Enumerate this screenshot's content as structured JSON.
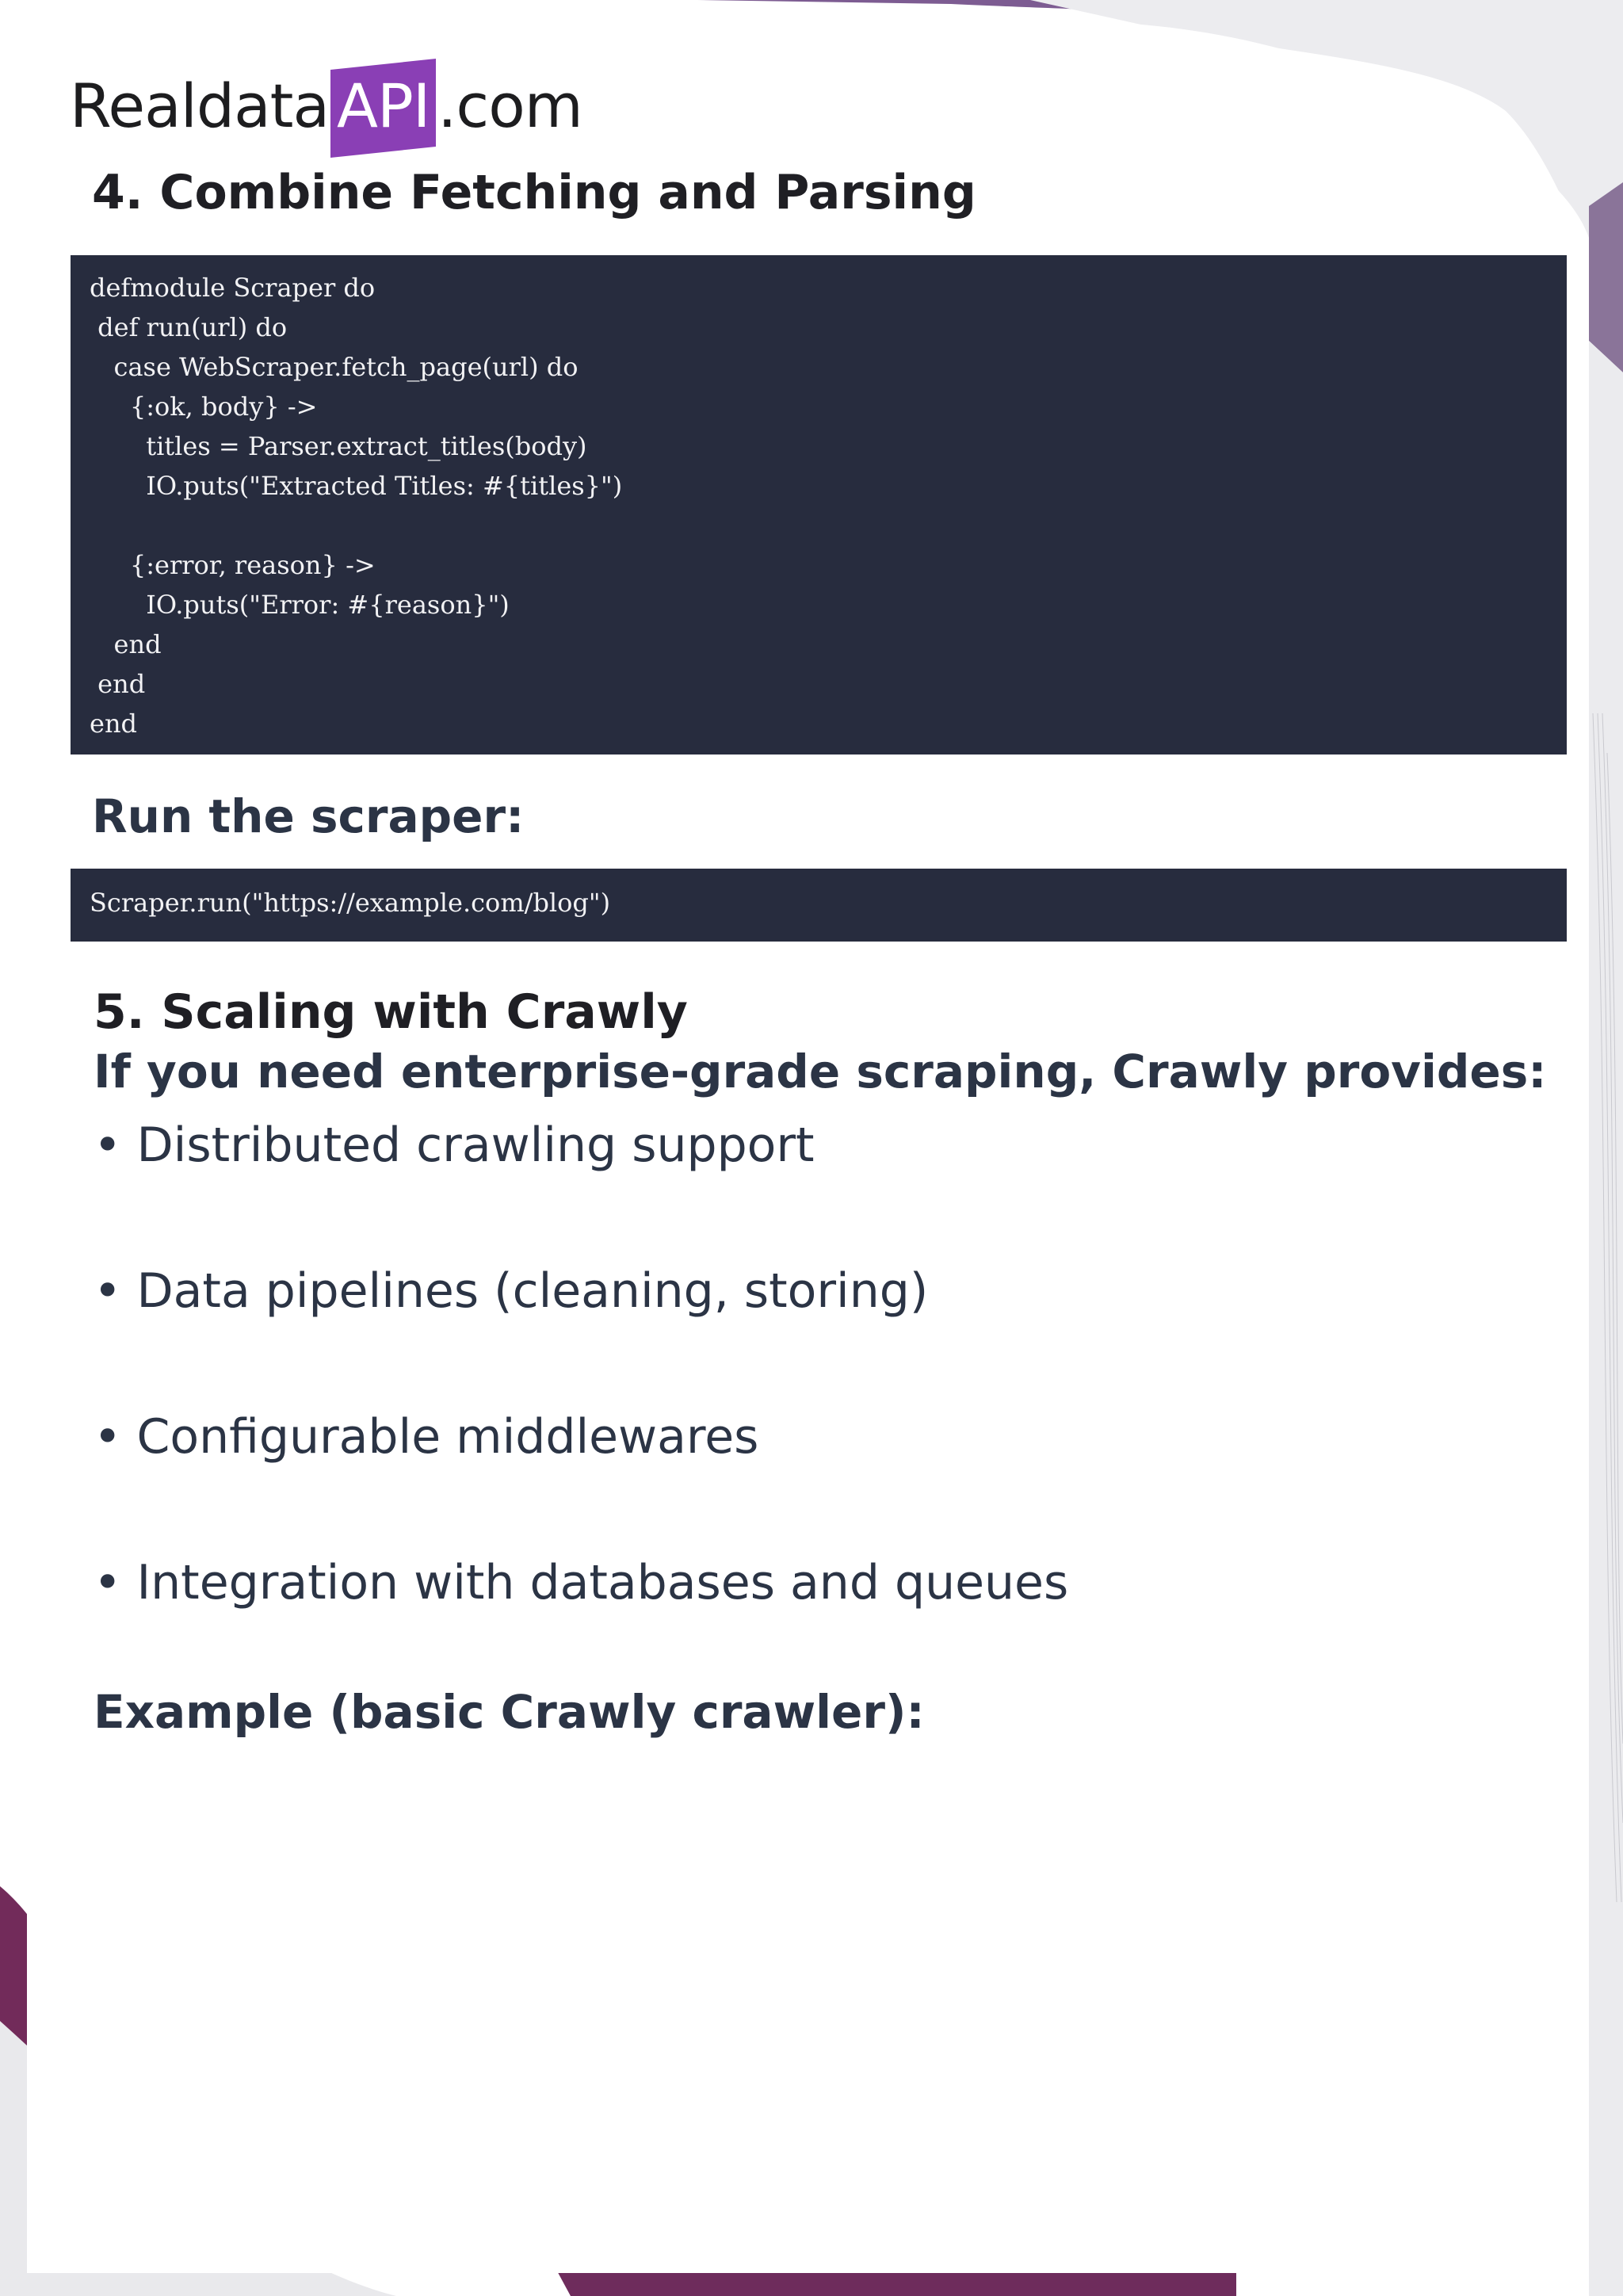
{
  "logo": {
    "prefix": "Realdata",
    "highlight": "API",
    "suffix": ".com"
  },
  "sections": {
    "combine_heading": "4. Combine Fetching and Parsing",
    "run_heading": "Run the scraper:",
    "scaling_heading": "5. Scaling with Crawly",
    "scaling_subheading": "If you need enterprise-grade scraping, Crawly provides:",
    "example_heading": "Example (basic Crawly crawler):"
  },
  "code_main": [
    "defmodule Scraper do",
    " def run(url) do",
    "   case WebScraper.fetch_page(url) do",
    "     {:ok, body} ->",
    "       titles = Parser.extract_titles(body)",
    "       IO.puts(\"Extracted Titles: #{titles}\")",
    "",
    "     {:error, reason} ->",
    "       IO.puts(\"Error: #{reason}\")",
    "   end",
    " end",
    "end"
  ],
  "code_run": "Scraper.run(\"https://example.com/blog\")",
  "bullets": [
    "• Distributed crawling support",
    "• Data pipelines (cleaning, storing)",
    "• Configurable middlewares",
    "• Integration with databases and queues"
  ],
  "colors": {
    "brand_purple": "#8a3fb5",
    "code_bg": "#272c3e",
    "heading_dark": "#1f1f24",
    "heading_slate": "#2b3445"
  }
}
